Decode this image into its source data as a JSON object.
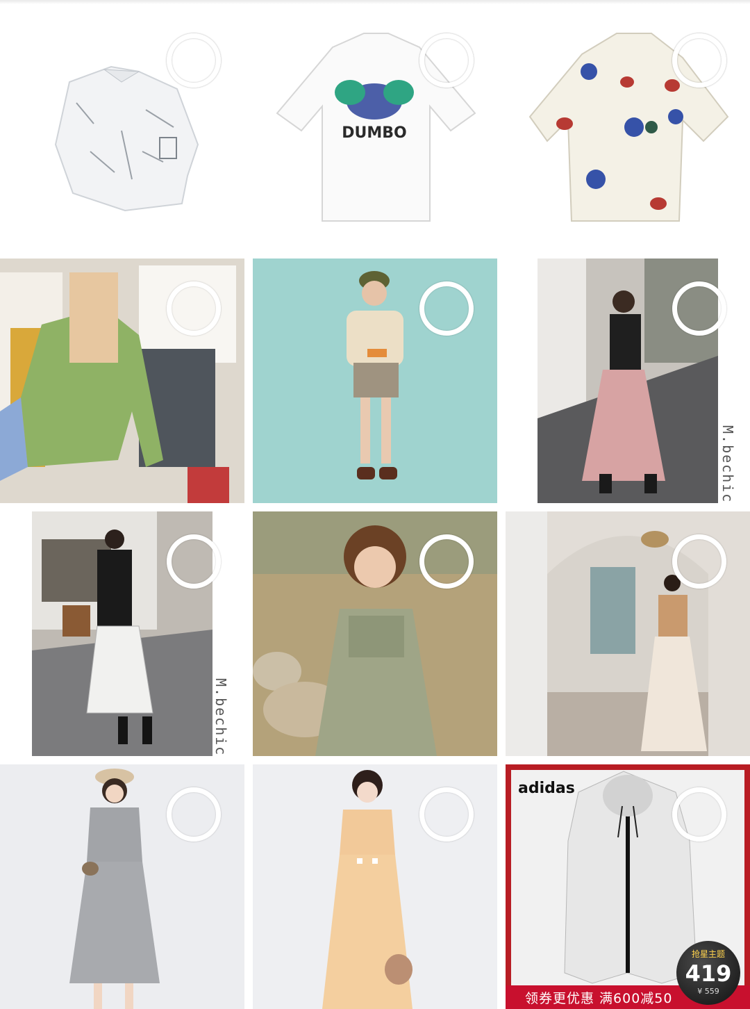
{
  "products": [
    {
      "name": "white-print-shirt",
      "bg": "#ffffff"
    },
    {
      "name": "dumbo-tshirt",
      "bg": "#ffffff",
      "print_text": "DUMBO"
    },
    {
      "name": "starfish-print-shirt",
      "bg": "#ffffff"
    },
    {
      "name": "green-cardigan-rack",
      "bg": "#d9d4cc"
    },
    {
      "name": "mint-background-outfit",
      "bg": "#9fd3cf"
    },
    {
      "name": "street-pink-skirt",
      "bg": "#c9c4bd",
      "watermark": "M.bechic"
    },
    {
      "name": "black-cardigan-plaid-skirt",
      "bg": "#cfcac2",
      "watermark": "M.bechic"
    },
    {
      "name": "green-floral-dress-field",
      "bg": "#b4a27a"
    },
    {
      "name": "embroidered-vest-dress",
      "bg": "#ddd6cf"
    },
    {
      "name": "grey-knit-dress",
      "bg": "#ecedf0"
    },
    {
      "name": "apricot-dress",
      "bg": "#eeeff2"
    },
    {
      "name": "adidas-white-jacket",
      "bg": "#e9e9e9",
      "brand": "adidas",
      "promo": "领券更优惠 满600减50",
      "badge": {
        "tag": "抢星主题",
        "price": "419",
        "sub": "¥ 559"
      }
    }
  ],
  "colors": {
    "selection_ring": "#ffffff",
    "promo_red": "#c8102e"
  }
}
